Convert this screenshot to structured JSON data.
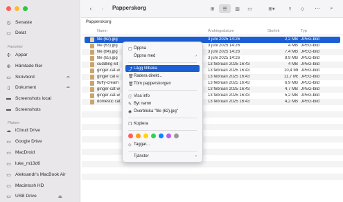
{
  "window": {
    "title": "Papperskorg",
    "path": "Papperskorg"
  },
  "sidebar": {
    "top_items": [
      {
        "label": "Senaste",
        "icon": "clock-icon"
      },
      {
        "label": "Delat",
        "icon": "shared-folder-icon"
      }
    ],
    "favorites_header": "Favoriter",
    "favorites": [
      {
        "label": "Appar",
        "icon": "apps-icon"
      },
      {
        "label": "Hämtade filer",
        "icon": "download-icon"
      },
      {
        "label": "Skrivbord",
        "icon": "desktop-icon"
      },
      {
        "label": "Dokument",
        "icon": "document-icon"
      },
      {
        "label": "Screenshots local",
        "icon": "folder-icon"
      },
      {
        "label": "Screenshots",
        "icon": "folder-icon"
      }
    ],
    "locations_header": "Platser",
    "locations": [
      {
        "label": "iCloud Drive",
        "icon": "cloud-icon"
      },
      {
        "label": "Google Drive",
        "icon": "drive-icon"
      },
      {
        "label": "MacDroid",
        "icon": "drive-icon"
      },
      {
        "label": "luke_m13d6",
        "icon": "drive-icon"
      },
      {
        "label": "Aleksandr's MacBook Air",
        "icon": "laptop-icon"
      },
      {
        "label": "Macintosh HD",
        "icon": "disk-icon"
      },
      {
        "label": "USB Drive",
        "icon": "disk-icon"
      }
    ]
  },
  "columns": {
    "name": "Namn",
    "date": "Ändringsdatum",
    "size": "Storlek",
    "kind": "Typ"
  },
  "rows": [
    {
      "name": "file (62).jpg",
      "date": "3 juni 2025 14:26",
      "size": "2,2 MB",
      "kind": "JPEG-bild",
      "selected": true
    },
    {
      "name": "file (63).jpg",
      "date": "3 juni 2025 14:26",
      "size": "4 MB",
      "kind": "JPEG-bild"
    },
    {
      "name": "file (64).jpg",
      "date": "3 juni 2025 14:26",
      "size": "7,4 MB",
      "kind": "JPEG-bild"
    },
    {
      "name": "file (65).jpg",
      "date": "3 juni 2025 14:26",
      "size": "8,9 MB",
      "kind": "JPEG-bild"
    },
    {
      "name": "cuddling-kit",
      "date": "13 februari 2025 16:43",
      "size": "4 MB",
      "kind": "JPEG-bild"
    },
    {
      "name": "ginger-cat-w",
      "date": "13 februari 2025 16:43",
      "size": "10,4 MB",
      "kind": "JPEG-bild"
    },
    {
      "name": "ginger cat e",
      "date": "13 februari 2025 16:43",
      "size": "11,7 MB",
      "kind": "JPEG-bild"
    },
    {
      "name": "fluffy-cream",
      "date": "13 februari 2025 16:43",
      "size": "6,9 MB",
      "kind": "JPEG-bild"
    },
    {
      "name": "ginger-cat-w",
      "date": "13 februari 2025 16:43",
      "size": "4,7 MB",
      "kind": "JPEG-bild"
    },
    {
      "name": "ginger-cat-w",
      "date": "13 februari 2025 16:43",
      "size": "5,2 MB",
      "kind": "JPEG-bild"
    },
    {
      "name": "domestic cat",
      "date": "13 februari 2025 16:43",
      "size": "4,2 MB",
      "kind": "JPEG-bild"
    }
  ],
  "context_menu": {
    "open": "Öppna",
    "open_with": "Öppna med",
    "put_back": "Lägg tillbaka",
    "delete_now": "Radera direkt...",
    "empty_trash": "Töm papperskorgen",
    "get_info": "Visa info",
    "rename": "Byt namn",
    "quick_look": "Överblicka \"file (62).jpg\"",
    "copy": "Kopiera",
    "tags": "Taggar...",
    "services": "Tjänster",
    "tag_colors": [
      "#ff5f57",
      "#ff9f0a",
      "#ffd60a",
      "#30d158",
      "#0a84ff",
      "#bf5af2",
      "#98989d"
    ]
  },
  "colors": {
    "accent": "#1c5fd4"
  }
}
